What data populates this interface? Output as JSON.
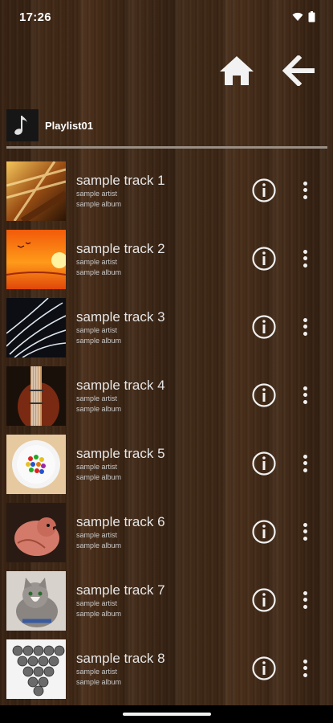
{
  "status": {
    "time": "17:26",
    "wifi_icon": "wifi-icon",
    "battery_icon": "battery-icon"
  },
  "toolbar": {
    "home_icon": "home-icon",
    "back_icon": "arrow-back-icon"
  },
  "playlist": {
    "name": "Playlist01",
    "icon": "music-note-icon"
  },
  "tracks": [
    {
      "title": "sample track 1",
      "artist": "sample artist",
      "album": "sample album",
      "art": "piano"
    },
    {
      "title": "sample track 2",
      "artist": "sample artist",
      "album": "sample album",
      "art": "sunset"
    },
    {
      "title": "sample track 3",
      "artist": "sample artist",
      "album": "sample album",
      "art": "feathers"
    },
    {
      "title": "sample track 4",
      "artist": "sample artist",
      "album": "sample album",
      "art": "guitar"
    },
    {
      "title": "sample track 5",
      "artist": "sample artist",
      "album": "sample album",
      "art": "candy"
    },
    {
      "title": "sample track 6",
      "artist": "sample artist",
      "album": "sample album",
      "art": "bird"
    },
    {
      "title": "sample track 7",
      "artist": "sample artist",
      "album": "sample album",
      "art": "cat"
    },
    {
      "title": "sample track 8",
      "artist": "sample artist",
      "album": "sample album",
      "art": "spheres"
    }
  ]
}
